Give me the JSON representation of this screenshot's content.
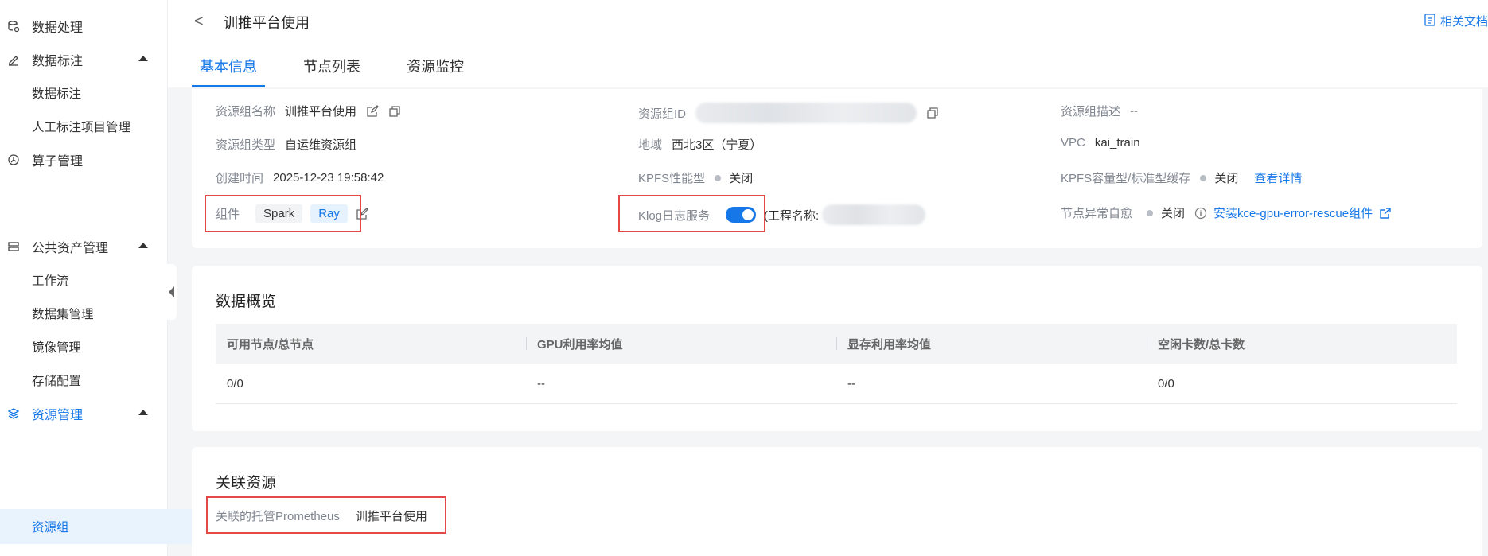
{
  "sidebar": {
    "items": [
      {
        "label": "数据处理",
        "icon": "data-processing-icon"
      },
      {
        "label": "数据标注",
        "icon": "pen-icon"
      },
      {
        "label": "数据标注"
      },
      {
        "label": "人工标注项目管理"
      },
      {
        "label": "算子管理",
        "icon": "operator-icon"
      },
      {
        "label": "公共资产管理",
        "icon": "asset-icon"
      },
      {
        "label": "工作流"
      },
      {
        "label": "数据集管理"
      },
      {
        "label": "镜像管理"
      },
      {
        "label": "存储配置"
      },
      {
        "label": "资源管理",
        "icon": "layers-icon"
      },
      {
        "label": "资源组"
      }
    ]
  },
  "header": {
    "back": "<",
    "title": "训推平台使用",
    "doc_link": "相关文档",
    "tabs": [
      {
        "label": "基本信息"
      },
      {
        "label": "节点列表"
      },
      {
        "label": "资源监控"
      }
    ]
  },
  "basic_info": {
    "name_label": "资源组名称",
    "name_value": "训推平台使用",
    "id_label": "资源组ID",
    "desc_label": "资源组描述",
    "desc_value": "--",
    "type_label": "资源组类型",
    "type_value": "自运维资源组",
    "region_label": "地域",
    "region_value": "西北3区（宁夏）",
    "vpc_label": "VPC",
    "vpc_value": "kai_train",
    "created_label": "创建时间",
    "created_value": "2025-12-23 19:58:42",
    "kpfs_perf_label": "KPFS性能型",
    "kpfs_perf_value": "关闭",
    "kpfs_cap_label": "KPFS容量型/标准型缓存",
    "kpfs_cap_value": "关闭",
    "kpfs_cap_link": "查看详情",
    "component_label": "组件",
    "component_tags": [
      "Spark",
      "Ray"
    ],
    "klog_label": "Klog日志服务",
    "klog_project_label": "(工程名称:",
    "node_heal_label": "节点异常自愈",
    "node_heal_value": "关闭",
    "node_heal_link": "安装kce-gpu-error-rescue组件"
  },
  "overview": {
    "title": "数据概览",
    "columns": [
      "可用节点/总节点",
      "GPU利用率均值",
      "显存利用率均值",
      "空闲卡数/总卡数"
    ],
    "rows": [
      [
        "0/0",
        "--",
        "--",
        "0/0"
      ]
    ]
  },
  "related": {
    "title": "关联资源",
    "prometheus_label": "关联的托管Prometheus",
    "prometheus_value": "训推平台使用"
  },
  "colors": {
    "accent": "#1677e8",
    "highlight_border": "#e54848"
  }
}
